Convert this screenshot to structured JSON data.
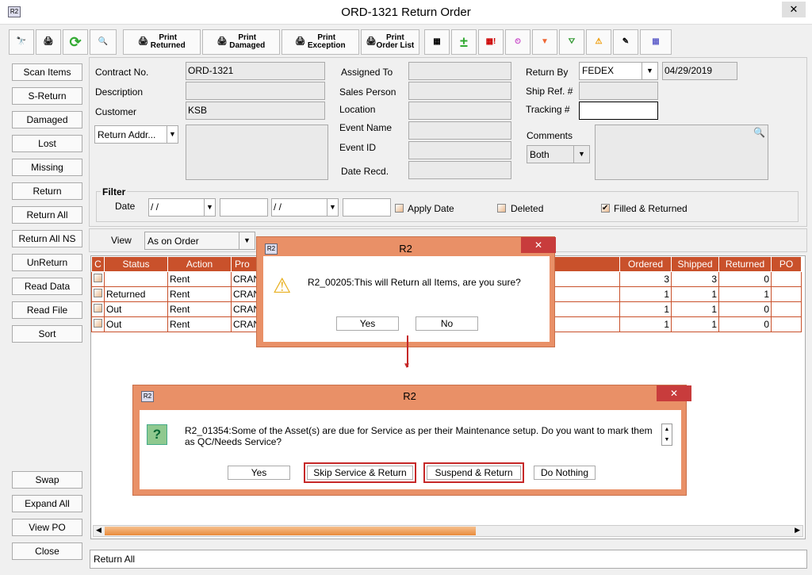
{
  "window": {
    "title": "ORD-1321 Return Order",
    "logo": "R2",
    "close": "✕"
  },
  "toolbar": {
    "print_returned": [
      "Print",
      "Returned"
    ],
    "print_damaged": [
      "Print",
      "Damaged"
    ],
    "print_exception": [
      "Print",
      "Exception"
    ],
    "print_order_list": [
      "Print",
      "Order List"
    ]
  },
  "left_buttons": [
    "Scan Items",
    "S-Return",
    "Damaged",
    "Lost",
    "Missing",
    "Return",
    "Return All",
    "Return All NS",
    "UnReturn",
    "Read Data",
    "Read File",
    "Sort"
  ],
  "bottom_buttons": [
    "Swap",
    "Expand All",
    "View PO",
    "Close"
  ],
  "form": {
    "contract_label": "Contract No.",
    "contract": "ORD-1321",
    "description_label": "Description",
    "customer_label": "Customer",
    "customer": "KSB",
    "return_addr": "Return Addr...",
    "assigned_to": "Assigned To",
    "sales_person": "Sales Person",
    "location": "Location",
    "event_name": "Event Name",
    "event_id": "Event ID",
    "date_recd": "Date Recd.",
    "return_by_label": "Return By",
    "return_by": "FEDEX",
    "return_date": "04/29/2019",
    "ship_ref": "Ship Ref. #",
    "tracking": "Tracking #",
    "comments": "Comments",
    "comments_filter": "Both"
  },
  "filter": {
    "title": "Filter",
    "date_label": "Date",
    "date_from": "/ /",
    "date_to": "/ /",
    "apply_date": "Apply Date",
    "deleted": "Deleted",
    "filled_returned": "Filled & Returned"
  },
  "view": {
    "label": "View",
    "value": "As on Order"
  },
  "table": {
    "headers": [
      "C",
      "Status",
      "Action",
      "Pro",
      "Ordered",
      "Shipped",
      "Returned",
      "PO"
    ],
    "rows": [
      {
        "status": "",
        "action": "Rent",
        "product": "CRAN",
        "ordered": "3",
        "shipped": "3",
        "returned": "0"
      },
      {
        "status": "Returned",
        "action": "Rent",
        "product": "CRAN",
        "ordered": "1",
        "shipped": "1",
        "returned": "1"
      },
      {
        "status": "Out",
        "action": "Rent",
        "product": "CRAN",
        "ordered": "1",
        "shipped": "1",
        "returned": "0"
      },
      {
        "status": "Out",
        "action": "Rent",
        "product": "CRAN",
        "ordered": "1",
        "shipped": "1",
        "returned": "0"
      }
    ]
  },
  "status_bar": "Return All",
  "dialog1": {
    "title": "R2",
    "message": "R2_00205:This will Return all Items, are you sure?",
    "yes": "Yes",
    "no": "No"
  },
  "dialog2": {
    "title": "R2",
    "message": "R2_01354:Some of the Asset(s) are due for Service as per their Maintenance setup. Do you want to mark them as QC/Needs Service?",
    "yes": "Yes",
    "skip": "Skip Service & Return",
    "suspend": "Suspend & Return",
    "nothing": "Do Nothing"
  }
}
